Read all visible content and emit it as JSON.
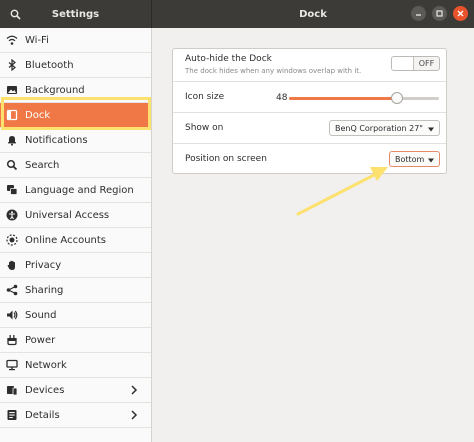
{
  "window": {
    "sidebar_title": "Settings",
    "panel_title": "Dock"
  },
  "sidebar": {
    "items": [
      {
        "label": "Wi-Fi",
        "icon": "wifi-icon"
      },
      {
        "label": "Bluetooth",
        "icon": "bluetooth-icon"
      },
      {
        "label": "Background",
        "icon": "background-icon"
      },
      {
        "label": "Dock",
        "icon": "dock-icon",
        "active": true
      },
      {
        "label": "Notifications",
        "icon": "bell-icon"
      },
      {
        "label": "Search",
        "icon": "search-icon"
      },
      {
        "label": "Language and Region",
        "icon": "language-icon"
      },
      {
        "label": "Universal Access",
        "icon": "accessibility-icon"
      },
      {
        "label": "Online Accounts",
        "icon": "accounts-icon"
      },
      {
        "label": "Privacy",
        "icon": "hand-icon"
      },
      {
        "label": "Sharing",
        "icon": "share-icon"
      },
      {
        "label": "Sound",
        "icon": "speaker-icon"
      },
      {
        "label": "Power",
        "icon": "power-icon"
      },
      {
        "label": "Network",
        "icon": "network-icon"
      },
      {
        "label": "Devices",
        "icon": "devices-icon",
        "has_submenu": true
      },
      {
        "label": "Details",
        "icon": "info-icon",
        "has_submenu": true
      }
    ]
  },
  "dock": {
    "autohide": {
      "label": "Auto-hide the Dock",
      "description": "The dock hides when any windows overlap with it.",
      "state": "OFF"
    },
    "icon_size": {
      "label": "Icon size",
      "value": "48",
      "fraction": 0.72
    },
    "show_on": {
      "label": "Show on",
      "value": "BenQ Corporation 27\""
    },
    "position": {
      "label": "Position on screen",
      "value": "Bottom"
    }
  },
  "colors": {
    "accent": "#f07746",
    "highlight": "#fce16e",
    "headerbar": "#3c3b37"
  }
}
